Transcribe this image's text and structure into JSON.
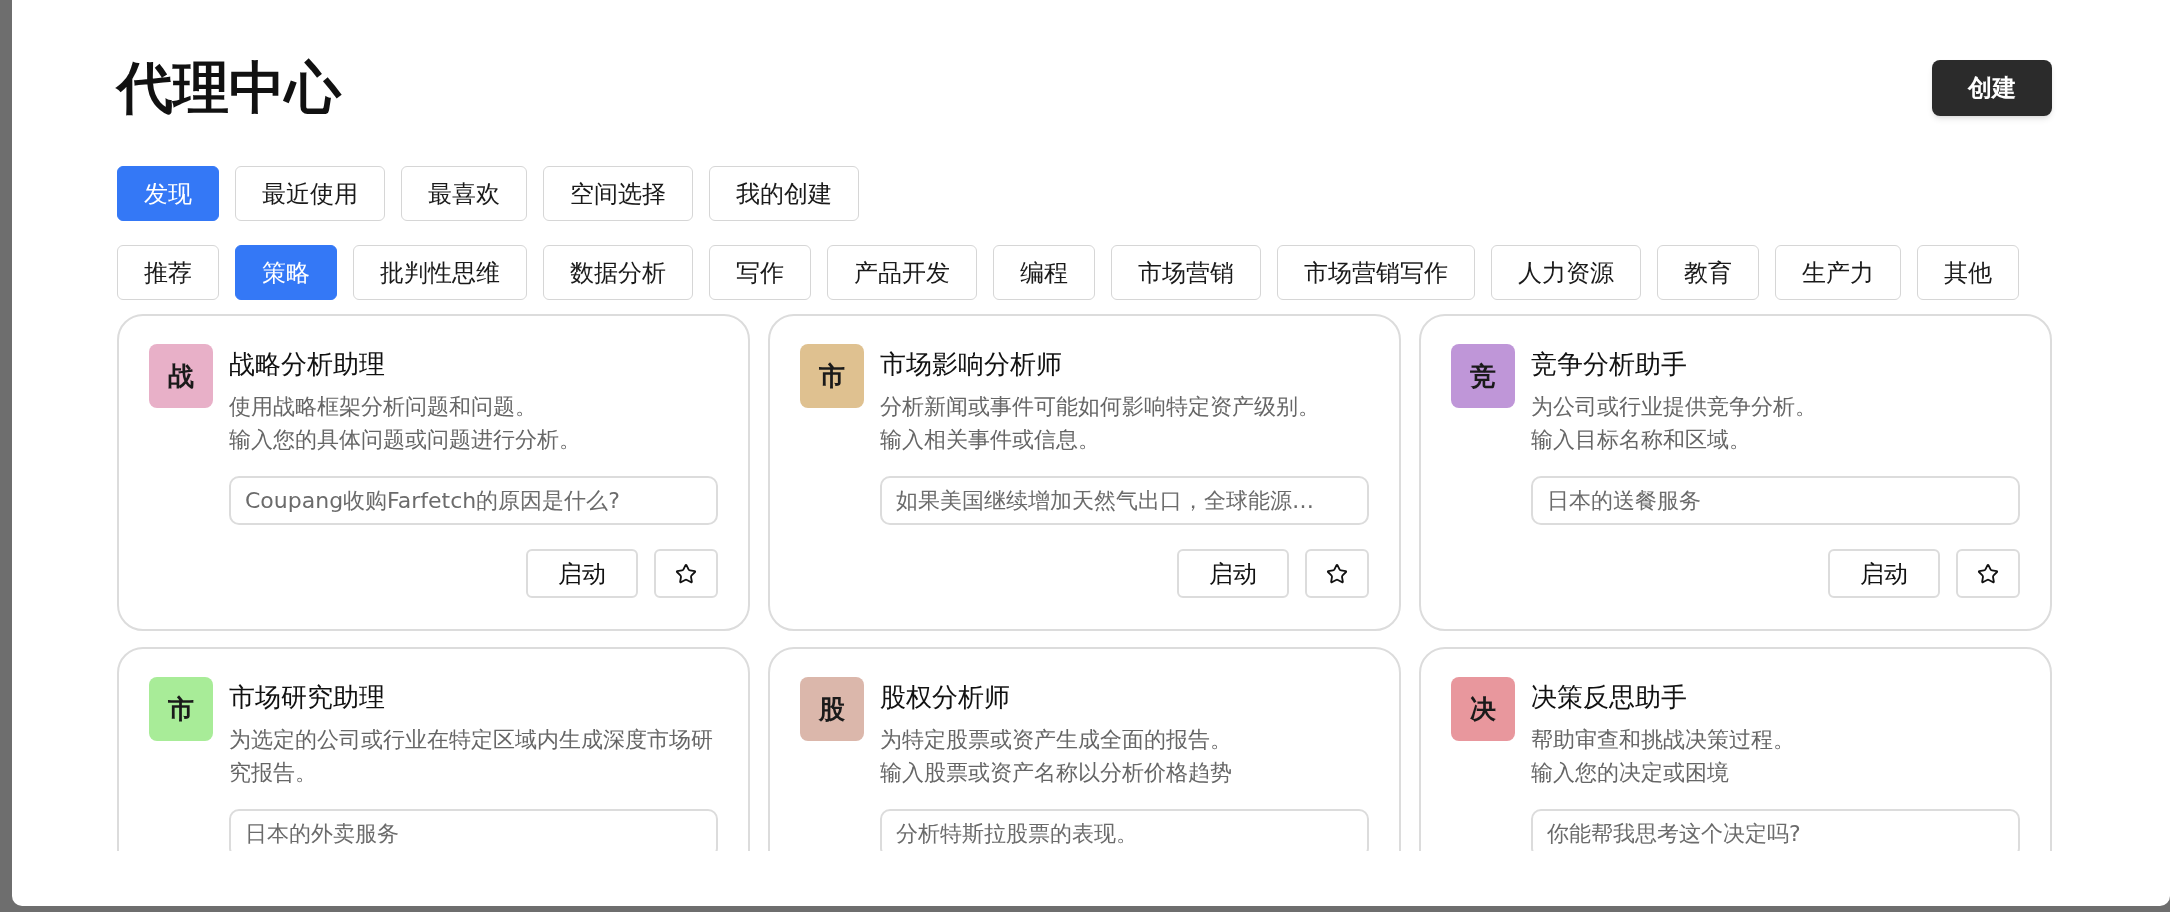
{
  "title": "代理中心",
  "create_button": "创建",
  "tabs": [
    {
      "label": "发现",
      "selected": true
    },
    {
      "label": "最近使用",
      "selected": false
    },
    {
      "label": "最喜欢",
      "selected": false
    },
    {
      "label": "空间选择",
      "selected": false
    },
    {
      "label": "我的创建",
      "selected": false
    }
  ],
  "categories": [
    {
      "label": "推荐",
      "selected": false
    },
    {
      "label": "策略",
      "selected": true
    },
    {
      "label": "批判性思维",
      "selected": false
    },
    {
      "label": "数据分析",
      "selected": false
    },
    {
      "label": "写作",
      "selected": false
    },
    {
      "label": "产品开发",
      "selected": false
    },
    {
      "label": "编程",
      "selected": false
    },
    {
      "label": "市场营销",
      "selected": false
    },
    {
      "label": "市场营销写作",
      "selected": false
    },
    {
      "label": "人力资源",
      "selected": false
    },
    {
      "label": "教育",
      "selected": false
    },
    {
      "label": "生产力",
      "selected": false
    },
    {
      "label": "其他",
      "selected": false
    }
  ],
  "cards": [
    {
      "badge": "战",
      "color": "#e8b0c8",
      "title": "战略分析助理",
      "description": [
        "使用战略框架分析问题和问题。",
        "输入您的具体问题或问题进行分析。"
      ],
      "placeholder": "Coupang收购Farfetch的原因是什么?",
      "start_button": "启动"
    },
    {
      "badge": "市",
      "color": "#dfc190",
      "title": "市场影响分析师",
      "description": [
        "分析新闻或事件可能如何影响特定资产级别。",
        "输入相关事件或信息。"
      ],
      "placeholder": "如果美国继续增加天然气出口，全球能源…",
      "start_button": "启动"
    },
    {
      "badge": "竞",
      "color": "#bf96d8",
      "title": "竞争分析助手",
      "description": [
        "为公司或行业提供竞争分析。",
        "输入目标名称和区域。"
      ],
      "placeholder": "日本的送餐服务",
      "start_button": "启动"
    },
    {
      "badge": "市",
      "color": "#a8ec98",
      "title": "市场研究助理",
      "description": [
        "为选定的公司或行业在特定区域内生成深度市场研究报告。"
      ],
      "placeholder": "日本的外卖服务"
    },
    {
      "badge": "股",
      "color": "#dbb7ab",
      "title": "股权分析师",
      "description": [
        "为特定股票或资产生成全面的报告。",
        "输入股票或资产名称以分析价格趋势"
      ],
      "placeholder": "分析特斯拉股票的表现。"
    },
    {
      "badge": "决",
      "color": "#e8979d",
      "title": "决策反思助手",
      "description": [
        "帮助审查和挑战决策过程。",
        "输入您的决定或困境"
      ],
      "placeholder": "你能帮我思考这个决定吗?"
    }
  ]
}
